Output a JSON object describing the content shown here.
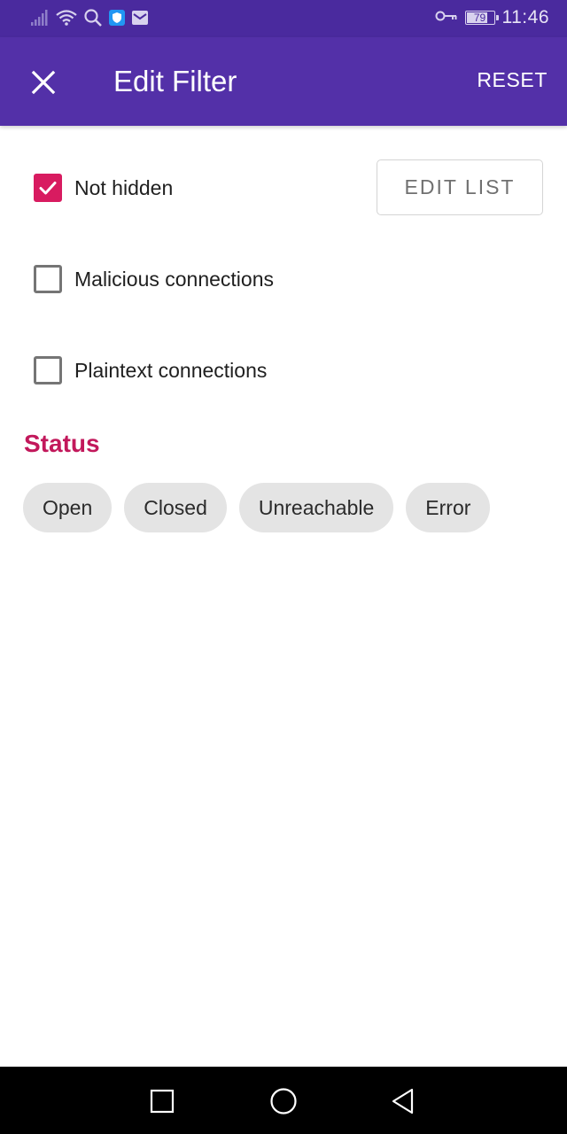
{
  "status_bar": {
    "time": "11:46",
    "battery_level": "79",
    "battery_fraction": 0.79,
    "icons": [
      "signal-icon",
      "wifi-icon",
      "search-icon",
      "shield-app-icon",
      "mail-icon",
      "vpn-key-icon",
      "battery-icon"
    ]
  },
  "app_bar": {
    "title": "Edit Filter",
    "reset_label": "RESET",
    "close_icon": "close-icon"
  },
  "filters": {
    "not_hidden": {
      "label": "Not hidden",
      "checked": true
    },
    "edit_list_label": "EDIT LIST",
    "malicious": {
      "label": "Malicious connections",
      "checked": false
    },
    "plaintext": {
      "label": "Plaintext connections",
      "checked": false
    }
  },
  "status_section": {
    "title": "Status",
    "chips": [
      {
        "label": "Open"
      },
      {
        "label": "Closed"
      },
      {
        "label": "Unreachable"
      },
      {
        "label": "Error"
      }
    ]
  },
  "nav_bar": {
    "icons": [
      "recents-square-icon",
      "home-circle-icon",
      "back-triangle-icon"
    ]
  },
  "colors": {
    "status_bar_bg": "#4a2a9e",
    "app_bar_bg": "#5330a8",
    "accent": "#d81b60",
    "section_title": "#c2185b",
    "chip_bg": "#e4e4e4"
  }
}
